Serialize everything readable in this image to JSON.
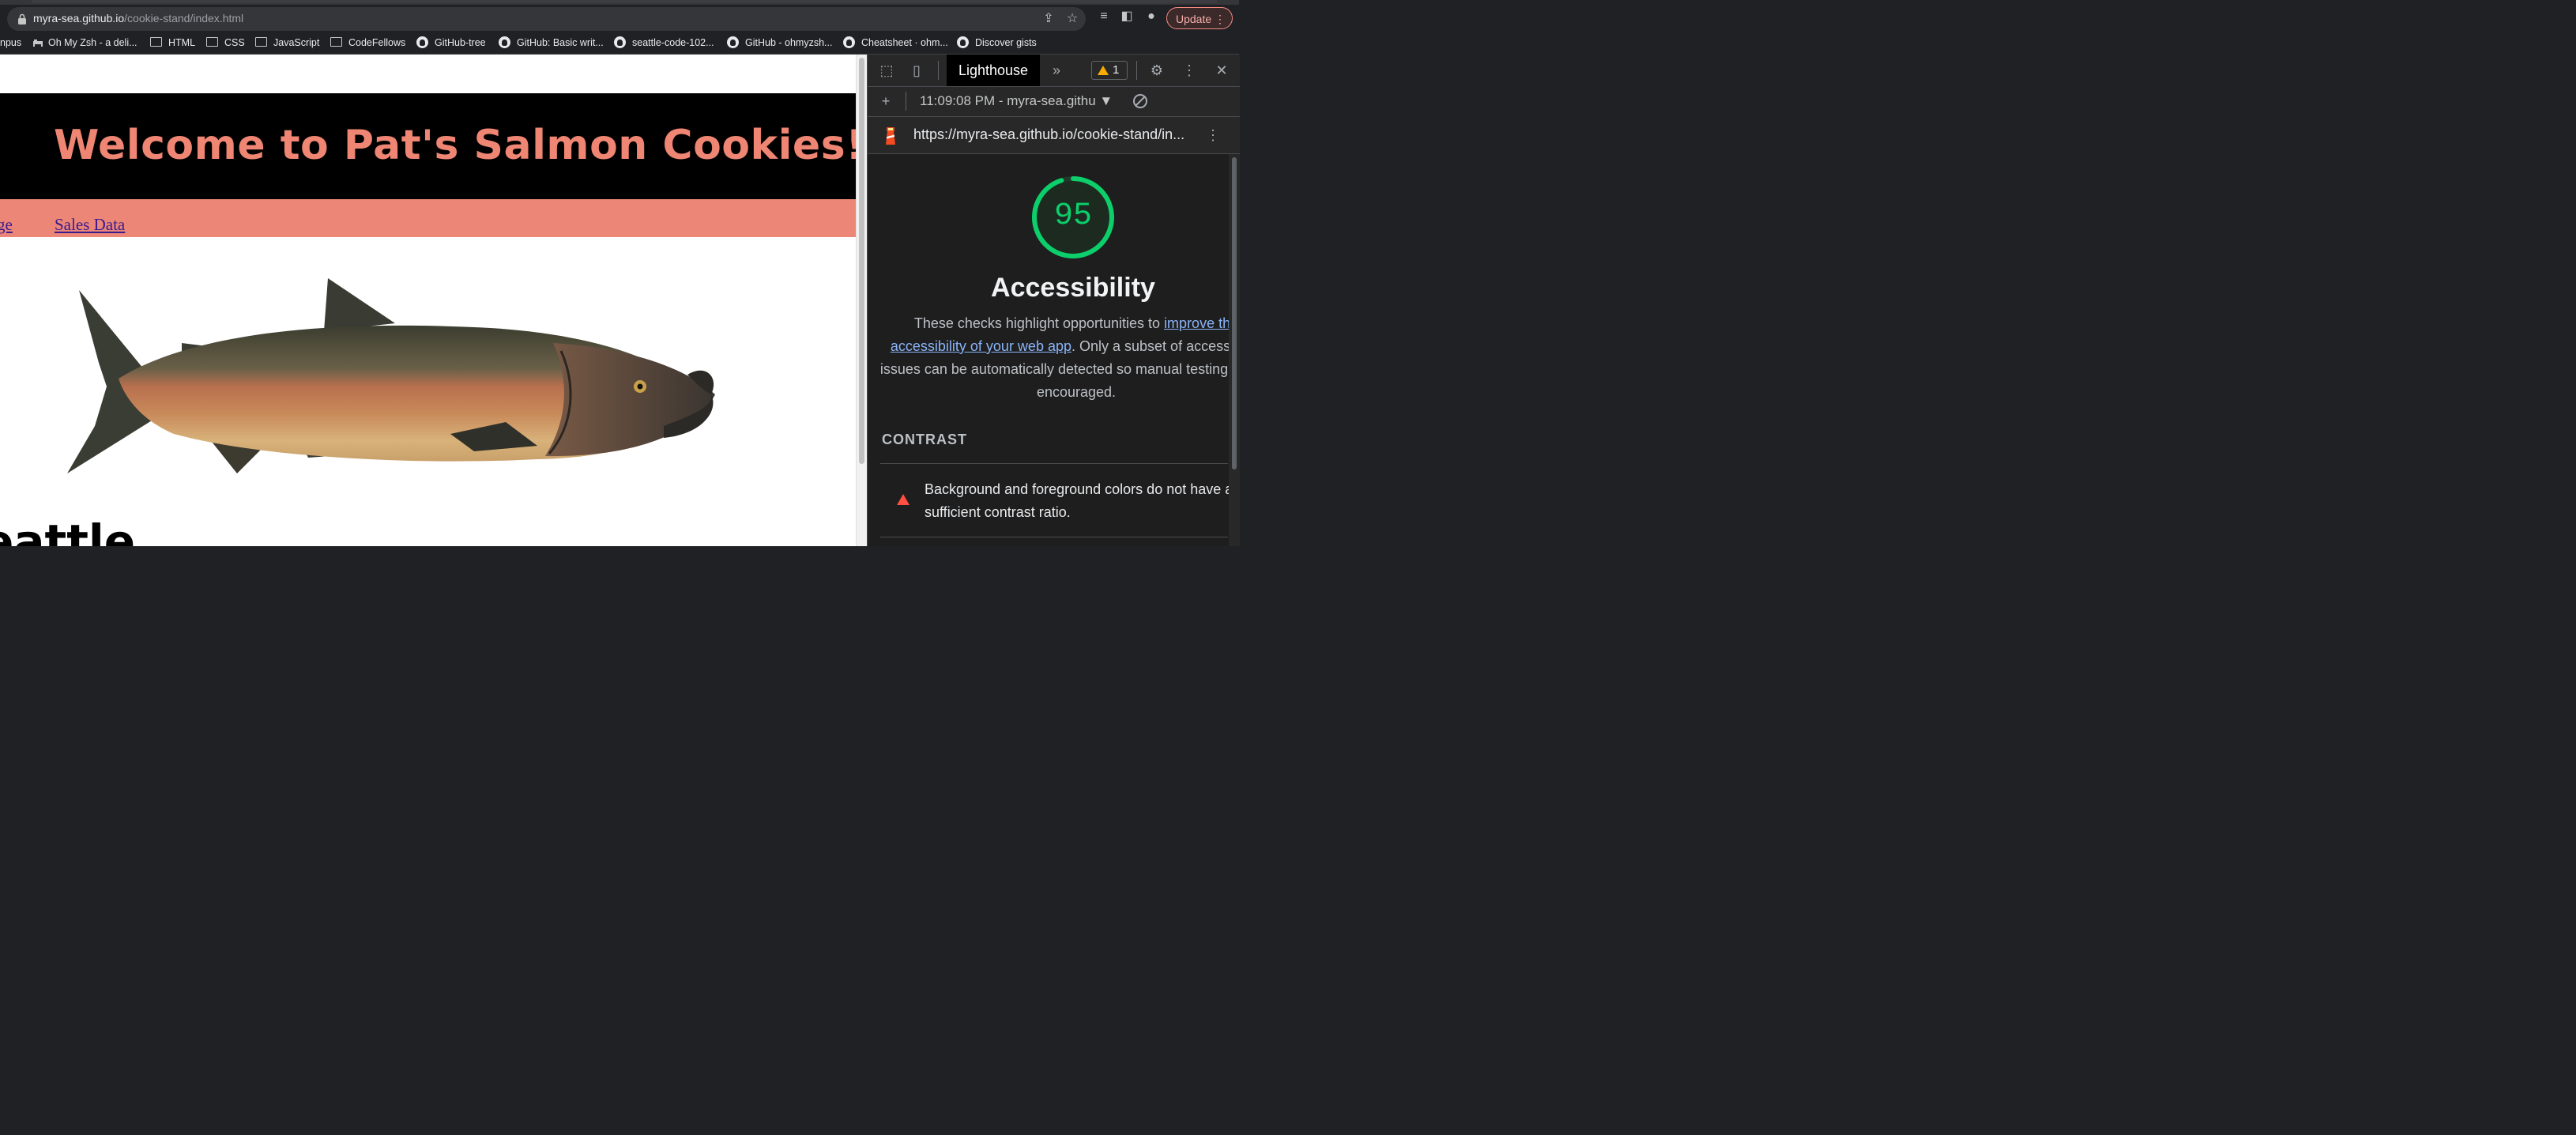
{
  "browser": {
    "url_host": "myra-sea.github.io",
    "url_path": "/cookie-stand/index.html",
    "update_label": "Update",
    "bookmarks": [
      {
        "label": "npus",
        "icon": "none"
      },
      {
        "label": "Oh My Zsh - a deli...",
        "icon": "bed-icon"
      },
      {
        "label": "HTML",
        "icon": "folder-icon"
      },
      {
        "label": "CSS",
        "icon": "folder-icon"
      },
      {
        "label": "JavaScript",
        "icon": "folder-icon"
      },
      {
        "label": "CodeFellows",
        "icon": "folder-icon"
      },
      {
        "label": "GitHub-tree",
        "icon": "github-icon"
      },
      {
        "label": "GitHub: Basic writ...",
        "icon": "github-icon"
      },
      {
        "label": "seattle-code-102...",
        "icon": "github-icon"
      },
      {
        "label": "GitHub - ohmyzsh...",
        "icon": "github-icon"
      },
      {
        "label": "Cheatsheet · ohm...",
        "icon": "github-icon"
      },
      {
        "label": "Discover gists",
        "icon": "github-icon"
      }
    ]
  },
  "page": {
    "title": "Welcome to Pat's Salmon Cookies!",
    "nav": [
      {
        "label": "ge"
      },
      {
        "label": "Sales Data"
      }
    ],
    "city_heading": "eattle",
    "colors": {
      "header_bg": "#000000",
      "title": "#ef8573",
      "nav_bg": "#ec8677"
    }
  },
  "devtools": {
    "active_tab": "Lighthouse",
    "warning_count": "1",
    "report_select": "11:09:08 PM - myra-sea.githu ▼",
    "report_url": "https://myra-sea.github.io/cookie-stand/in...",
    "score": "95",
    "score_fraction": 0.95,
    "category_title": "Accessibility",
    "desc_prefix": "These checks highlight opportunities to ",
    "desc_link": "improve the accessibility of your web app",
    "desc_suffix": ". Only a subset of accessibility issues can be automatically detected so manual testing is also encouraged.",
    "group_title": "CONTRAST",
    "audit_text": "Background and foreground colors do not have a sufficient contrast ratio.",
    "colors": {
      "pass": "#0cce6b",
      "fail": "#ff4e42",
      "link": "#8ab4f8"
    }
  }
}
